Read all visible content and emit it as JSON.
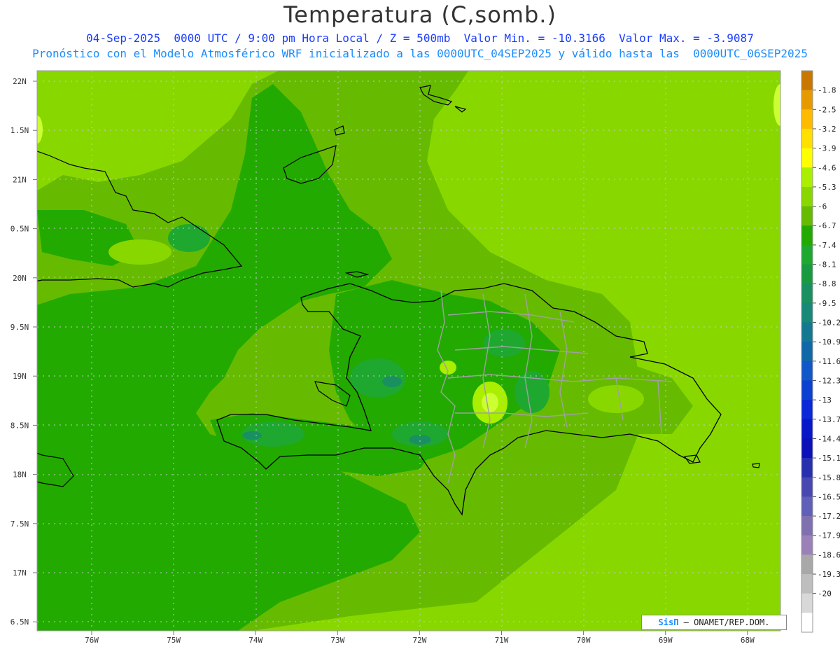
{
  "header": {
    "title": "Temperatura (C,somb.)",
    "line1": "04-Sep-2025  0000 UTC / 9:00 pm Hora Local / Z = 500mb  Valor Min. = -10.3166  Valor Max. = -3.9087",
    "line2": "Pronóstico con el Modelo Atmosférico WRF inicializado a las 0000UTC_04SEP2025 y válido hasta las  0000UTC_06SEP2025"
  },
  "map": {
    "lat_labels": [
      "22N",
      "1.5N",
      "21N",
      "0.5N",
      "20N",
      "9.5N",
      "19N",
      "8.5N",
      "18N",
      "7.5N",
      "17N",
      "6.5N"
    ],
    "lon_labels": [
      "76W",
      "75W",
      "74W",
      "73W",
      "72W",
      "71W",
      "70W",
      "69W",
      "68W"
    ]
  },
  "legend": {
    "levels": [
      "-1.8",
      "-2.5",
      "-3.2",
      "-3.9",
      "-4.6",
      "-5.3",
      "-6",
      "-6.7",
      "-7.4",
      "-8.1",
      "-8.8",
      "-9.5",
      "-10.2",
      "-10.9",
      "-11.6",
      "-12.3",
      "-13",
      "-13.7",
      "-14.4",
      "-15.1",
      "-15.8",
      "-16.5",
      "-17.2",
      "-17.9",
      "-18.6",
      "-19.3",
      "-20"
    ],
    "colors": [
      "#c87800",
      "#e69a00",
      "#ffbb00",
      "#ffe000",
      "#ffff00",
      "#aaee00",
      "#88d800",
      "#66bb00",
      "#22aa00",
      "#1ea830",
      "#1a9a40",
      "#1a9060",
      "#188878",
      "#147890",
      "#1068a8",
      "#1058c8",
      "#0c40d0",
      "#0a28d8",
      "#0818c8",
      "#0c10b8",
      "#2830b0",
      "#4848b0",
      "#6060b8",
      "#8070b0",
      "#9a82b8",
      "#a8a8a8",
      "#bebebe",
      "#d8d8d8",
      "#ffffff"
    ]
  },
  "credit": {
    "brand": "SisΠ",
    "org": " – ONAMET/REP.DOM."
  }
}
